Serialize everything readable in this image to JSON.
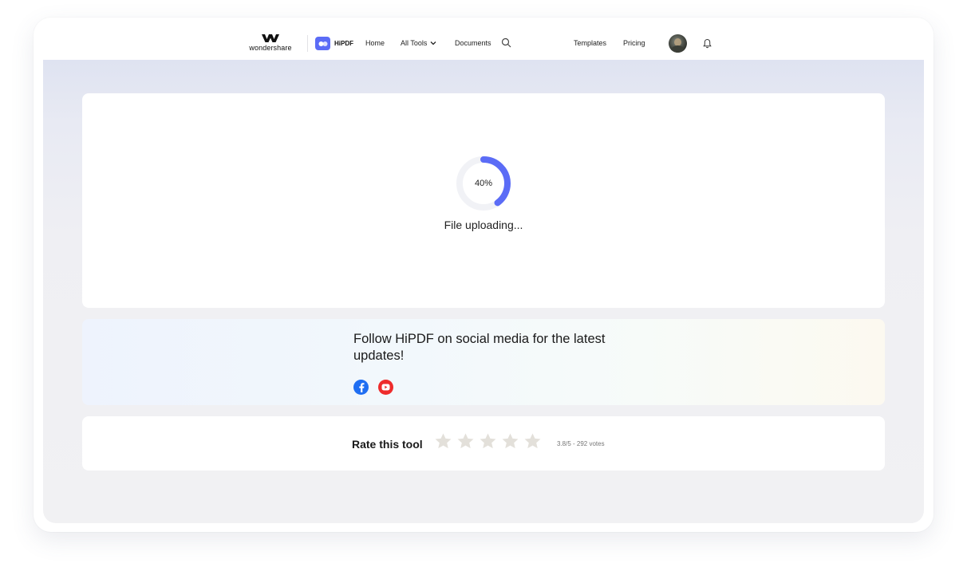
{
  "header": {
    "brand_text": "wondershare",
    "product_name": "HiPDF",
    "nav": {
      "home": "Home",
      "all_tools": "All Tools",
      "documents": "Documents",
      "templates": "Templates",
      "pricing": "Pricing"
    },
    "icons": [
      "wondershare-logo-icon",
      "hipdf-logo-icon",
      "chevron-down-icon",
      "search-icon",
      "avatar",
      "bell-icon"
    ]
  },
  "upload": {
    "progress": 40,
    "progress_label": "40%",
    "status": "File uploading...",
    "colors": {
      "progress": "#5b6cf6",
      "track": "#f1f2f6"
    }
  },
  "social": {
    "title": "Follow HiPDF on social media for the latest updates!",
    "icons": [
      "facebook-icon",
      "youtube-icon"
    ],
    "colors": {
      "facebook": "#1f6ef2",
      "youtube": "#ee2b2b"
    }
  },
  "rating": {
    "label": "Rate this tool",
    "stars": 5,
    "votes_text": "3.8/5 - 292 votes",
    "colors": {
      "star": "#e3e0da"
    }
  }
}
